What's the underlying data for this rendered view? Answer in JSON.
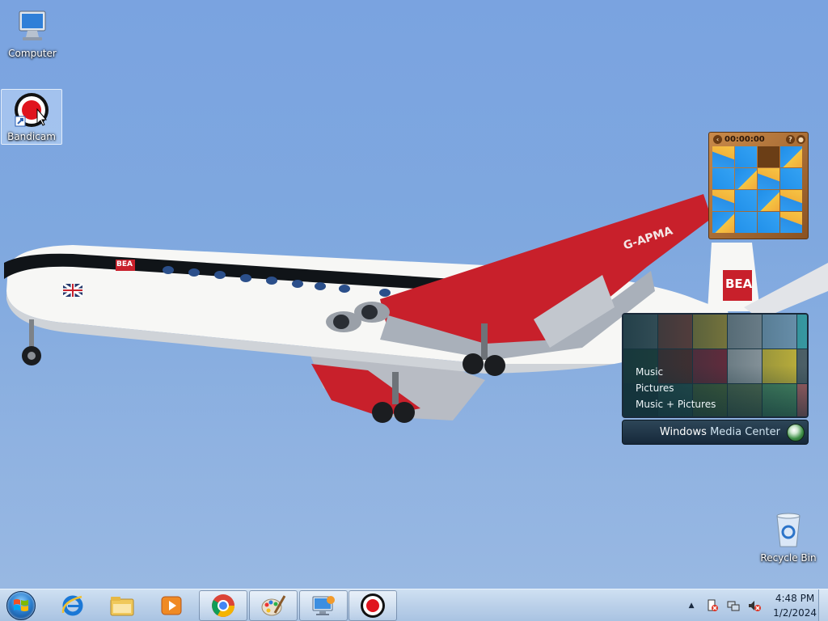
{
  "desktop": {
    "icons": [
      {
        "label": "Computer",
        "icon": "computer-icon"
      },
      {
        "label": "Bandicam",
        "icon": "bandicam-icon"
      },
      {
        "label": "Recycle Bin",
        "icon": "recycle-bin-icon"
      }
    ]
  },
  "wallpaper": {
    "aircraft_registration": "G-APMA",
    "airline_mark": "BEA"
  },
  "puzzle_gadget": {
    "timer": "00:00:00",
    "help_label": "?"
  },
  "media_center_gadget": {
    "menu": [
      "Music",
      "Pictures",
      "Music + Pictures"
    ],
    "title_bold": "Windows",
    "title_light": "Media Center"
  },
  "taskbar": {
    "pinned": [
      {
        "name": "internet-explorer-icon"
      },
      {
        "name": "windows-explorer-icon"
      },
      {
        "name": "media-player-icon"
      },
      {
        "name": "chrome-icon"
      },
      {
        "name": "paint-icon"
      },
      {
        "name": "remote-desktop-icon"
      },
      {
        "name": "bandicam-taskbar-icon"
      }
    ],
    "tray": {
      "show_hidden": "▲"
    },
    "clock": {
      "time": "4:48 PM",
      "date": "1/2/2024"
    }
  },
  "colors": {
    "sky": "#7fa8df",
    "taskbar": "#bdd2ea",
    "bea_red": "#c8202b"
  }
}
